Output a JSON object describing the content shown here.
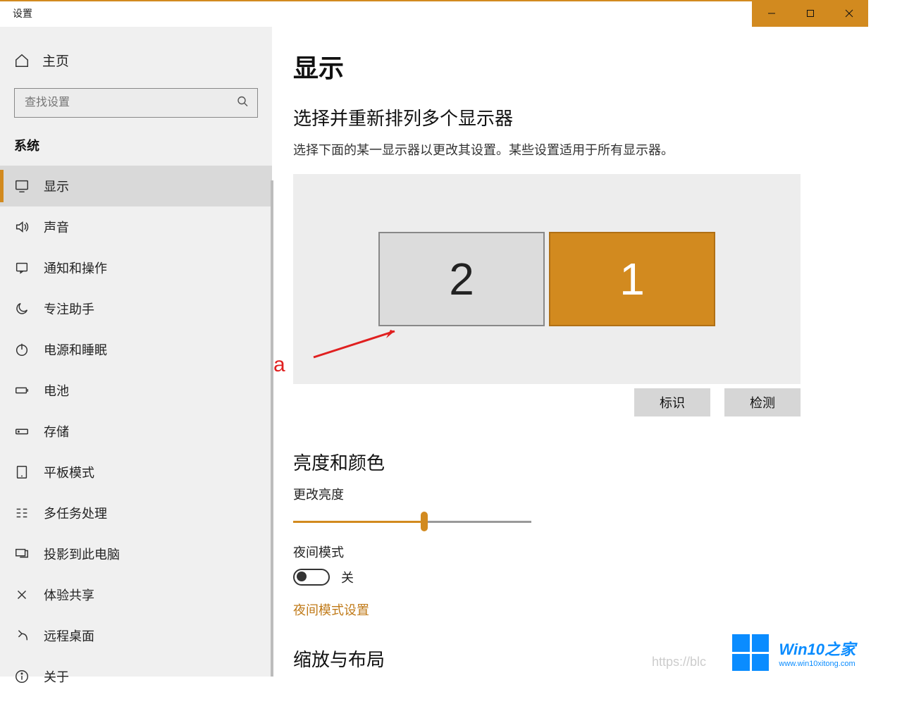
{
  "window": {
    "title": "设置",
    "accent_color": "#d28a1f"
  },
  "sidebar": {
    "home_label": "主页",
    "search_placeholder": "查找设置",
    "group_label": "系统",
    "items": [
      {
        "label": "显示",
        "icon": "monitor-icon",
        "active": true
      },
      {
        "label": "声音",
        "icon": "speaker-icon",
        "active": false
      },
      {
        "label": "通知和操作",
        "icon": "notification-icon",
        "active": false
      },
      {
        "label": "专注助手",
        "icon": "moon-icon",
        "active": false
      },
      {
        "label": "电源和睡眠",
        "icon": "power-icon",
        "active": false
      },
      {
        "label": "电池",
        "icon": "battery-icon",
        "active": false
      },
      {
        "label": "存储",
        "icon": "storage-icon",
        "active": false
      },
      {
        "label": "平板模式",
        "icon": "tablet-icon",
        "active": false
      },
      {
        "label": "多任务处理",
        "icon": "multitask-icon",
        "active": false
      },
      {
        "label": "投影到此电脑",
        "icon": "project-icon",
        "active": false
      },
      {
        "label": "体验共享",
        "icon": "share-icon",
        "active": false
      },
      {
        "label": "远程桌面",
        "icon": "remote-icon",
        "active": false
      },
      {
        "label": "关于",
        "icon": "info-icon",
        "active": false
      }
    ]
  },
  "main": {
    "page_title": "显示",
    "arrange": {
      "heading": "选择并重新排列多个显示器",
      "description": "选择下面的某一显示器以更改其设置。某些设置适用于所有显示器。",
      "monitors": [
        {
          "id": "2",
          "selected": false
        },
        {
          "id": "1",
          "selected": true
        }
      ],
      "identify_btn": "标识",
      "detect_btn": "检测"
    },
    "brightness": {
      "heading": "亮度和颜色",
      "slider_label": "更改亮度",
      "slider_value_pct": 55,
      "night_mode_label": "夜间模式",
      "night_mode_state": "关",
      "night_mode_link": "夜间模式设置"
    },
    "scale": {
      "heading": "缩放与布局"
    },
    "annotation_letter": "a"
  },
  "watermark": {
    "brand": "Win10之家",
    "url": "www.win10xitong.com",
    "faint_text": "https://blc"
  }
}
